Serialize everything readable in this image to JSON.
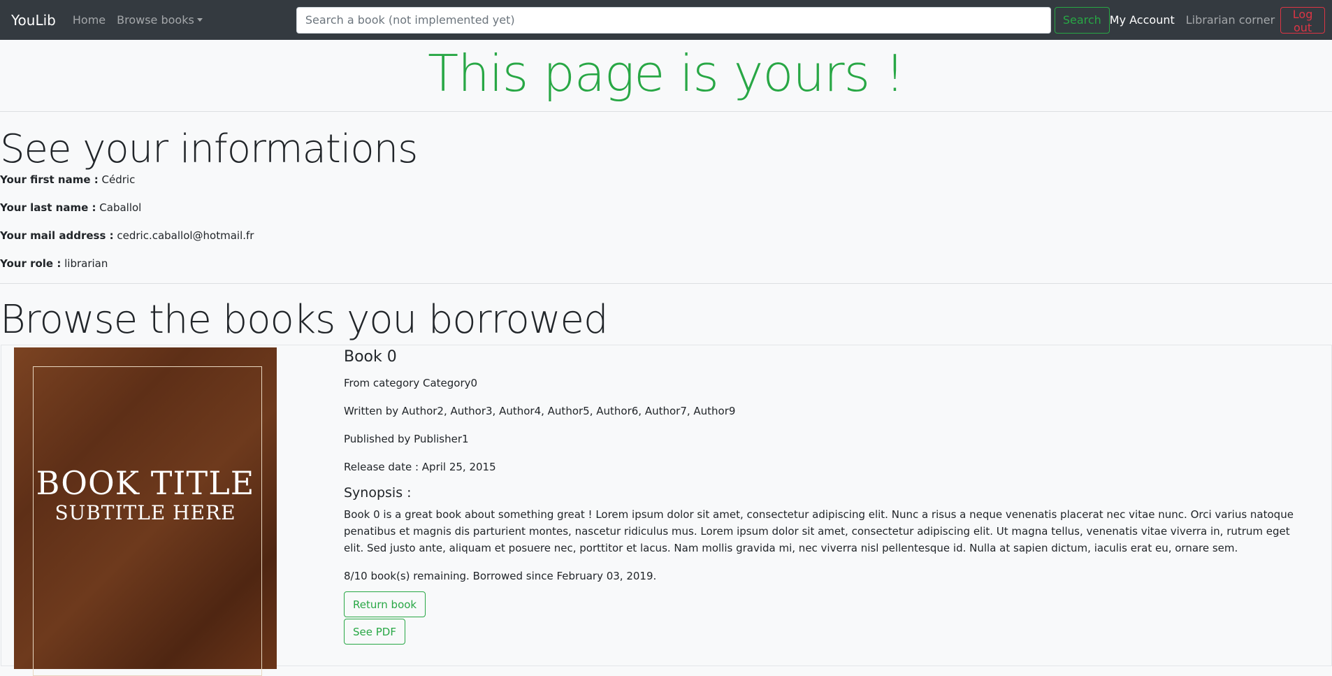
{
  "navbar": {
    "brand": "YouLib",
    "home": "Home",
    "browse": "Browse books",
    "search_placeholder": "Search a book (not implemented yet)",
    "search_button": "Search",
    "my_account": "My Account",
    "librarian_corner": "Librarian corner",
    "logout": "Log out"
  },
  "page": {
    "title": "This page is yours !"
  },
  "info": {
    "heading": "See your informations",
    "first_name_label": "Your first name :",
    "first_name": "Cédric",
    "last_name_label": "Your last name :",
    "last_name": "Caballol",
    "mail_label": "Your mail address :",
    "mail": "cedric.caballol@hotmail.fr",
    "role_label": "Your role :",
    "role": "librarian"
  },
  "books": {
    "heading": "Browse the books you borrowed",
    "items": [
      {
        "cover_title": "BOOK TITLE",
        "cover_subtitle": "SUBTITLE HERE",
        "title": "Book 0",
        "category": "From category Category0",
        "authors": "Written by Author2, Author3, Author4, Author5, Author6, Author7, Author9",
        "publisher": "Published by Publisher1",
        "release": "Release date : April 25, 2015",
        "synopsis_heading": "Synopsis :",
        "synopsis": "Book 0 is a great book about something great ! Lorem ipsum dolor sit amet, consectetur adipiscing elit. Nunc a risus a neque venenatis placerat nec vitae nunc. Orci varius natoque penatibus et magnis dis parturient montes, nascetur ridiculus mus. Lorem ipsum dolor sit amet, consectetur adipiscing elit. Ut magna tellus, venenatis vitae viverra in, rutrum eget elit. Sed justo ante, aliquam et posuere nec, porttitor et lacus. Nam mollis gravida mi, nec viverra nisl pellentesque id. Nulla at sapien dictum, iaculis erat eu, ornare sem.",
        "status": "8/10 book(s) remaining. Borrowed since February 03, 2019.",
        "return_button": "Return book",
        "pdf_button": "See PDF"
      }
    ]
  },
  "colors": {
    "navbar_bg": "#343a40",
    "success": "#28a745",
    "danger": "#dc3545",
    "page_bg": "#f8f9fa"
  }
}
